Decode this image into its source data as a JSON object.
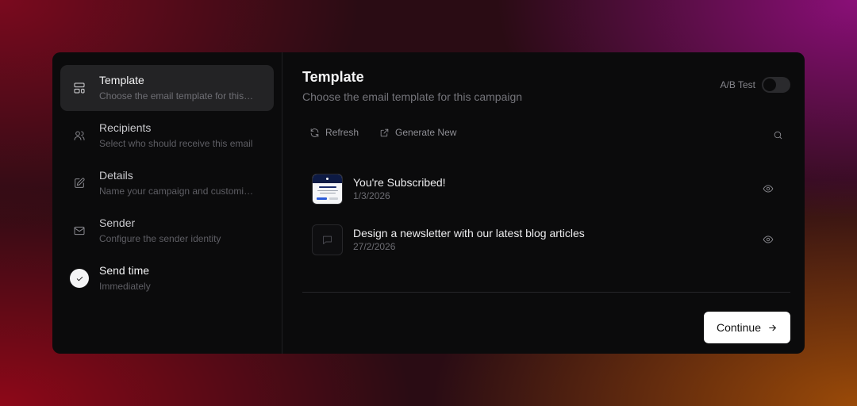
{
  "steps": [
    {
      "title": "Template",
      "desc": "Choose the email template for this campaign",
      "icon": "layout-template-icon",
      "state": "active"
    },
    {
      "title": "Recipients",
      "desc": "Select who should receive this email",
      "icon": "users-icon",
      "state": "pending"
    },
    {
      "title": "Details",
      "desc": "Name your campaign and customize it",
      "icon": "edit-icon",
      "state": "pending"
    },
    {
      "title": "Sender",
      "desc": "Configure the sender identity",
      "icon": "mail-icon",
      "state": "pending"
    },
    {
      "title": "Send time",
      "desc": "Immediately",
      "icon": "check-icon",
      "state": "done"
    }
  ],
  "main": {
    "title": "Template",
    "subtitle": "Choose the email template for this campaign",
    "ab_test_label": "A/B Test",
    "ab_test_enabled": false
  },
  "toolbar": {
    "refresh_label": "Refresh",
    "generate_label": "Generate New"
  },
  "templates": [
    {
      "name": "You're Subscribed!",
      "date": "1/3/2026",
      "thumbnail": "email-preview"
    },
    {
      "name": "Design a newsletter with our latest blog articles",
      "date": "27/2/2026",
      "thumbnail": "chat-icon"
    }
  ],
  "footer": {
    "continue_label": "Continue"
  }
}
